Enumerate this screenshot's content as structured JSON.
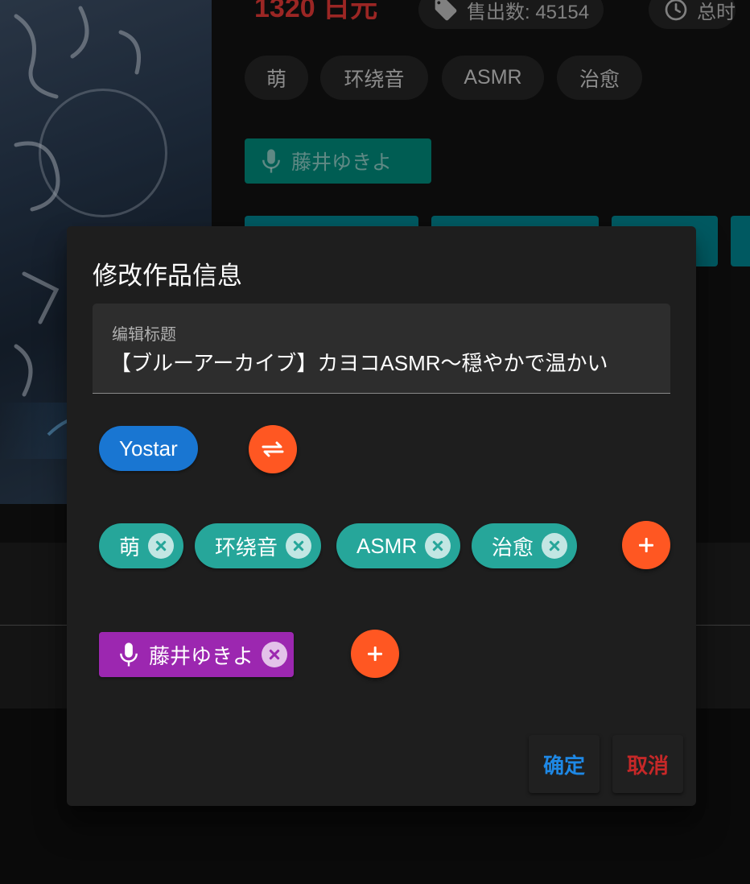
{
  "background": {
    "price": "1320 日元",
    "sales": "售出数: 45154",
    "duration": "总时",
    "tags": [
      "萌",
      "环绕音",
      "ASMR",
      "治愈"
    ],
    "voice_actor": "藤井ゆきよ"
  },
  "dialog": {
    "title": "修改作品信息",
    "title_field": {
      "label": "编辑标题",
      "value": "【ブルーアーカイブ】カヨコASMR〜穏やかで温かい"
    },
    "circle": {
      "name": "Yostar",
      "swap_icon": "swap-horiz-icon"
    },
    "tags": [
      {
        "label": "萌"
      },
      {
        "label": "环绕音"
      },
      {
        "label": "ASMR"
      },
      {
        "label": "治愈"
      }
    ],
    "voice_actors": [
      {
        "label": "藤井ゆきよ",
        "icon": "mic-icon"
      }
    ],
    "confirm_label": "确定",
    "cancel_label": "取消"
  },
  "colors": {
    "accent_orange": "#ff5722",
    "tag_teal": "#26a69a",
    "circle_blue": "#1976d2",
    "va_purple": "#9c27b0",
    "confirm_blue": "#1e88e5",
    "cancel_red": "#c62828",
    "price_red": "#e53935"
  }
}
